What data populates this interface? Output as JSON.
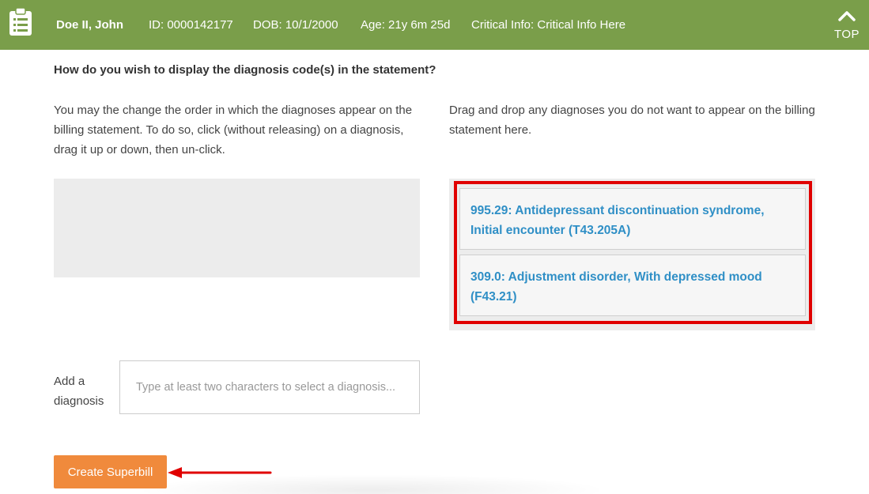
{
  "header": {
    "patient_name": "Doe II, John",
    "id": "ID: 0000142177",
    "dob": "DOB: 10/1/2000",
    "age": "Age: 21y 6m 25d",
    "critical_info": "Critical Info: Critical Info Here",
    "top_label": "TOP"
  },
  "main": {
    "question": "How do you wish to display the diagnosis code(s) in the statement?",
    "left_instructions": "You may the change the order in which the diagnoses appear on the billing statement. To do so, click (without releasing) on a diagnosis, drag it up or down, then un-click.",
    "right_instructions": "Drag and drop any diagnoses you do not want to appear on the billing statement here.",
    "excluded_diagnoses": [
      "995.29: Antidepressant discontinuation syndrome, Initial encounter (T43.205A)",
      "309.0: Adjustment disorder, With depressed mood (F43.21)"
    ],
    "add_diagnosis_label": "Add a diagnosis",
    "add_diagnosis_placeholder": "Type at least two characters to select a diagnosis...",
    "create_button": "Create Superbill"
  },
  "colors": {
    "header_bg": "#7a9e4a",
    "accent_orange": "#f08a3c",
    "link_blue": "#2f8fc6",
    "highlight_red": "#e00000"
  }
}
